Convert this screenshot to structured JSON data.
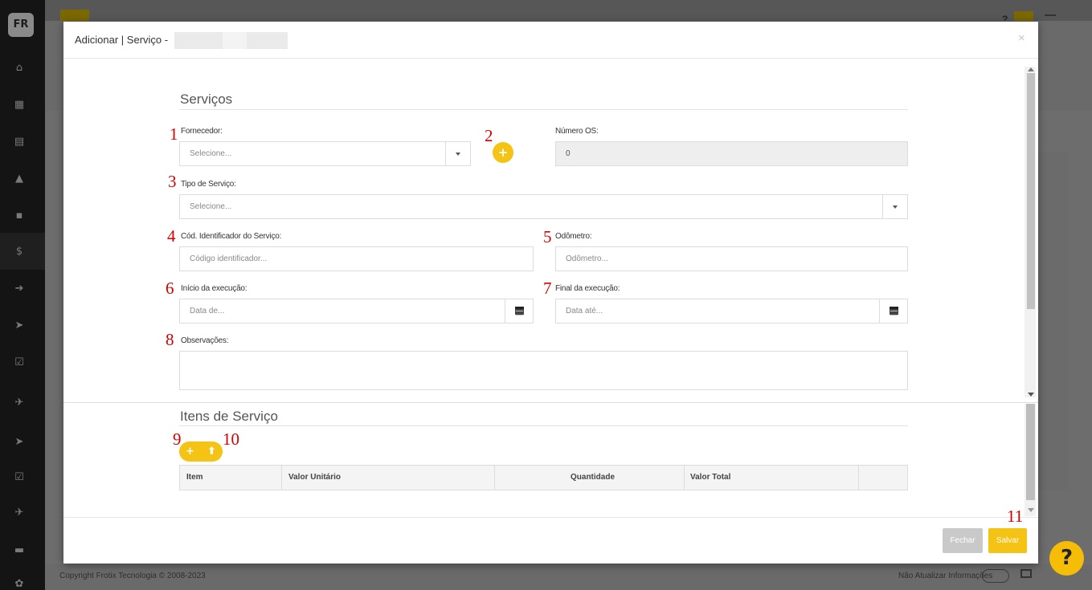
{
  "app": {
    "logo": "FR",
    "copyright": "Copyright Frotix Tecnologia © 2008-2023",
    "no_update_label": "Não Atualizar Informações",
    "help_icon": "?"
  },
  "sidebar": {
    "icons": [
      "home-icon",
      "dashboard-icon",
      "map-icon",
      "warning-icon",
      "building-icon",
      "dollar-icon",
      "sign-in-icon",
      "send-icon",
      "check-square-icon",
      "rocket-icon",
      "send-icon-2",
      "check-square-icon-2",
      "rocket-icon-2",
      "truck-icon",
      "cogs-icon"
    ],
    "glyphs": [
      "⌂",
      "▦",
      "▤",
      "▲",
      "▪",
      "$",
      "➔",
      "➤",
      "☑",
      "✈",
      "➤",
      "☑",
      "✈",
      "▬",
      "✿"
    ]
  },
  "modal": {
    "title": "Adicionar | Serviço -",
    "close": "×",
    "section_services": "Serviços",
    "section_items": "Itens de Serviço",
    "fields": {
      "fornecedor": {
        "label": "Fornecedor:",
        "placeholder": "Selecione..."
      },
      "numero_os": {
        "label": "Número OS:",
        "value": "0"
      },
      "tipo_servico": {
        "label": "Tipo de Serviço:",
        "placeholder": "Selecione..."
      },
      "cod_identificador": {
        "label": "Cód. Identificador do Serviço:",
        "placeholder": "Código identificador..."
      },
      "odometro": {
        "label": "Odômetro:",
        "placeholder": "Odômetro..."
      },
      "inicio_execucao": {
        "label": "Início da execução:",
        "placeholder": "Data de..."
      },
      "final_execucao": {
        "label": "Final da execução:",
        "placeholder": "Data até..."
      },
      "observacoes": {
        "label": "Observações:"
      }
    },
    "add_fornecedor_icon": "+",
    "items_buttons": {
      "add_icon": "+",
      "upload_icon": "⬆"
    },
    "table_headers": [
      "Item",
      "Valor Unitário",
      "Quantidade",
      "Valor Total"
    ],
    "buttons": {
      "fechar": "Fechar",
      "salvar": "Salvar"
    }
  },
  "annotations": [
    "1",
    "2",
    "3",
    "4",
    "5",
    "6",
    "7",
    "8",
    "9",
    "10",
    "11"
  ],
  "colors": {
    "accent": "#f5c313",
    "annotation": "#d40000",
    "sidebar": "#141414"
  }
}
